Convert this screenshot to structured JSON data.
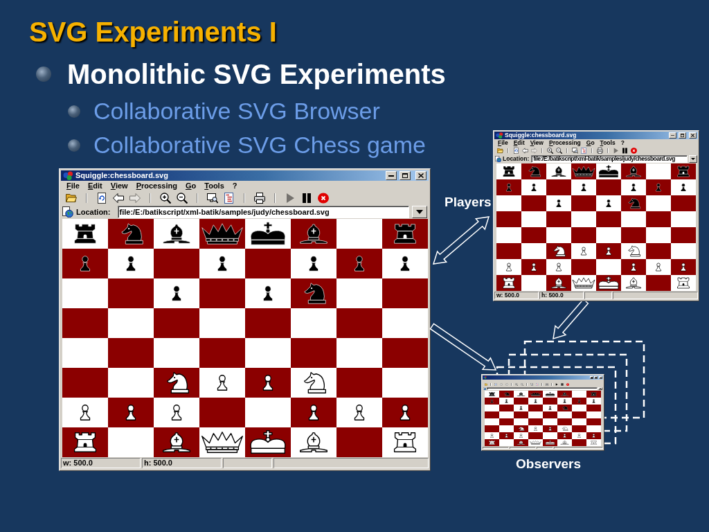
{
  "slide": {
    "title": "SVG Experiments I",
    "bullets": [
      {
        "text": "Monolithic SVG Experiments",
        "children": [
          {
            "text": "Collaborative SVG Browser"
          },
          {
            "text": "Collaborative SVG Chess game"
          }
        ]
      }
    ]
  },
  "main_window": {
    "title": "Squiggle:chessboard.svg",
    "menu": [
      "File",
      "Edit",
      "View",
      "Processing",
      "Go",
      "Tools",
      "?"
    ],
    "toolbar": [
      {
        "kind": "open",
        "disabled": false
      },
      {
        "kind": "separator"
      },
      {
        "kind": "reload",
        "disabled": false
      },
      {
        "kind": "back",
        "disabled": false
      },
      {
        "kind": "forward",
        "disabled": true
      },
      {
        "kind": "separator"
      },
      {
        "kind": "zoom_in",
        "disabled": false
      },
      {
        "kind": "zoom_out",
        "disabled": false
      },
      {
        "kind": "separator"
      },
      {
        "kind": "thumbnail",
        "disabled": false
      },
      {
        "kind": "source",
        "disabled": false
      },
      {
        "kind": "separator"
      },
      {
        "kind": "print",
        "disabled": false
      },
      {
        "kind": "separator"
      },
      {
        "kind": "play",
        "disabled": true
      },
      {
        "kind": "pause",
        "disabled": false
      },
      {
        "kind": "stop",
        "disabled": false
      }
    ],
    "location": {
      "label": "Location:",
      "value": "file:/E:/batikscript/xml-batik/samples/judy/chessboard.svg"
    },
    "board": [
      [
        {
          "kind": "black_rook"
        },
        {
          "kind": "black_knight"
        },
        {
          "kind": "black_bishop"
        },
        {
          "kind": "black_queen"
        },
        {
          "kind": "black_king"
        },
        {
          "kind": "black_bishop"
        },
        {
          "kind": "empty"
        },
        {
          "kind": "black_rook"
        }
      ],
      [
        {
          "kind": "black_pawn"
        },
        {
          "kind": "black_pawn"
        },
        {
          "kind": "empty"
        },
        {
          "kind": "black_pawn"
        },
        {
          "kind": "empty"
        },
        {
          "kind": "black_pawn"
        },
        {
          "kind": "black_pawn"
        },
        {
          "kind": "black_pawn"
        }
      ],
      [
        {
          "kind": "empty"
        },
        {
          "kind": "empty"
        },
        {
          "kind": "black_pawn"
        },
        {
          "kind": "empty"
        },
        {
          "kind": "black_pawn"
        },
        {
          "kind": "black_knight"
        },
        {
          "kind": "empty"
        },
        {
          "kind": "empty"
        }
      ],
      [
        {
          "kind": "empty"
        },
        {
          "kind": "empty"
        },
        {
          "kind": "empty"
        },
        {
          "kind": "empty"
        },
        {
          "kind": "empty"
        },
        {
          "kind": "empty"
        },
        {
          "kind": "empty"
        },
        {
          "kind": "empty"
        }
      ],
      [
        {
          "kind": "empty"
        },
        {
          "kind": "empty"
        },
        {
          "kind": "empty"
        },
        {
          "kind": "empty"
        },
        {
          "kind": "empty"
        },
        {
          "kind": "empty"
        },
        {
          "kind": "empty"
        },
        {
          "kind": "empty"
        }
      ],
      [
        {
          "kind": "empty"
        },
        {
          "kind": "empty"
        },
        {
          "kind": "white_knight"
        },
        {
          "kind": "white_pawn"
        },
        {
          "kind": "white_pawn"
        },
        {
          "kind": "white_knight"
        },
        {
          "kind": "empty"
        },
        {
          "kind": "empty"
        }
      ],
      [
        {
          "kind": "white_pawn"
        },
        {
          "kind": "white_pawn"
        },
        {
          "kind": "white_pawn"
        },
        {
          "kind": "empty"
        },
        {
          "kind": "empty"
        },
        {
          "kind": "white_pawn"
        },
        {
          "kind": "white_pawn"
        },
        {
          "kind": "white_pawn"
        }
      ],
      [
        {
          "kind": "white_rook"
        },
        {
          "kind": "empty"
        },
        {
          "kind": "white_bishop"
        },
        {
          "kind": "white_queen"
        },
        {
          "kind": "white_king"
        },
        {
          "kind": "white_bishop"
        },
        {
          "kind": "empty"
        },
        {
          "kind": "white_rook"
        }
      ]
    ],
    "status": [
      "w: 500.0",
      "h: 500.0"
    ]
  },
  "players_window": {
    "title": "Squiggle:chessboard.svg",
    "menu": [
      "File",
      "Edit",
      "View",
      "Processing",
      "Go",
      "Tools",
      "?"
    ],
    "toolbar": [
      {
        "kind": "open",
        "disabled": false
      },
      {
        "kind": "separator"
      },
      {
        "kind": "reload",
        "disabled": false
      },
      {
        "kind": "back",
        "disabled": false
      },
      {
        "kind": "forward",
        "disabled": true
      },
      {
        "kind": "separator"
      },
      {
        "kind": "zoom_in",
        "disabled": false
      },
      {
        "kind": "zoom_out",
        "disabled": false
      },
      {
        "kind": "separator"
      },
      {
        "kind": "thumbnail",
        "disabled": false
      },
      {
        "kind": "source",
        "disabled": false
      },
      {
        "kind": "separator"
      },
      {
        "kind": "print",
        "disabled": false
      },
      {
        "kind": "separator"
      },
      {
        "kind": "play",
        "disabled": true
      },
      {
        "kind": "pause",
        "disabled": false
      },
      {
        "kind": "stop",
        "disabled": false
      }
    ],
    "location": {
      "label": "Location:",
      "value": "file:/E:/batikscript/xml-batik/samples/judy/chessboard.svg"
    },
    "board": [
      [
        {
          "kind": "black_rook"
        },
        {
          "kind": "black_knight"
        },
        {
          "kind": "black_bishop"
        },
        {
          "kind": "black_queen"
        },
        {
          "kind": "black_king"
        },
        {
          "kind": "black_bishop"
        },
        {
          "kind": "empty"
        },
        {
          "kind": "black_rook"
        }
      ],
      [
        {
          "kind": "black_pawn"
        },
        {
          "kind": "black_pawn"
        },
        {
          "kind": "empty"
        },
        {
          "kind": "black_pawn"
        },
        {
          "kind": "empty"
        },
        {
          "kind": "black_pawn"
        },
        {
          "kind": "black_pawn"
        },
        {
          "kind": "black_pawn"
        }
      ],
      [
        {
          "kind": "empty"
        },
        {
          "kind": "empty"
        },
        {
          "kind": "black_pawn"
        },
        {
          "kind": "empty"
        },
        {
          "kind": "black_pawn"
        },
        {
          "kind": "black_knight"
        },
        {
          "kind": "empty"
        },
        {
          "kind": "empty"
        }
      ],
      [
        {
          "kind": "empty"
        },
        {
          "kind": "empty"
        },
        {
          "kind": "empty"
        },
        {
          "kind": "empty"
        },
        {
          "kind": "empty"
        },
        {
          "kind": "empty"
        },
        {
          "kind": "empty"
        },
        {
          "kind": "empty"
        }
      ],
      [
        {
          "kind": "empty"
        },
        {
          "kind": "empty"
        },
        {
          "kind": "empty"
        },
        {
          "kind": "empty"
        },
        {
          "kind": "empty"
        },
        {
          "kind": "empty"
        },
        {
          "kind": "empty"
        },
        {
          "kind": "empty"
        }
      ],
      [
        {
          "kind": "empty"
        },
        {
          "kind": "empty"
        },
        {
          "kind": "white_knight"
        },
        {
          "kind": "white_pawn"
        },
        {
          "kind": "white_pawn"
        },
        {
          "kind": "white_knight"
        },
        {
          "kind": "empty"
        },
        {
          "kind": "empty"
        }
      ],
      [
        {
          "kind": "white_pawn"
        },
        {
          "kind": "white_pawn"
        },
        {
          "kind": "white_pawn"
        },
        {
          "kind": "empty"
        },
        {
          "kind": "empty"
        },
        {
          "kind": "white_pawn"
        },
        {
          "kind": "white_pawn"
        },
        {
          "kind": "white_pawn"
        }
      ],
      [
        {
          "kind": "white_rook"
        },
        {
          "kind": "empty"
        },
        {
          "kind": "white_bishop"
        },
        {
          "kind": "white_queen"
        },
        {
          "kind": "white_king"
        },
        {
          "kind": "white_bishop"
        },
        {
          "kind": "empty"
        },
        {
          "kind": "white_rook"
        }
      ]
    ],
    "status": [
      "w: 500.0",
      "h: 500.0"
    ]
  },
  "observer_window": {
    "toolbar": [
      {
        "kind": "open"
      },
      {
        "kind": "separator"
      },
      {
        "kind": "reload"
      },
      {
        "kind": "back"
      },
      {
        "kind": "forward"
      },
      {
        "kind": "separator"
      },
      {
        "kind": "zoom_in"
      },
      {
        "kind": "zoom_out"
      },
      {
        "kind": "separator"
      },
      {
        "kind": "thumbnail"
      },
      {
        "kind": "source"
      },
      {
        "kind": "separator"
      },
      {
        "kind": "print"
      },
      {
        "kind": "separator"
      },
      {
        "kind": "play"
      },
      {
        "kind": "pause"
      },
      {
        "kind": "stop"
      }
    ],
    "board": [
      [
        {
          "kind": "black_rook"
        },
        {
          "kind": "black_knight"
        },
        {
          "kind": "black_bishop"
        },
        {
          "kind": "black_queen"
        },
        {
          "kind": "black_king"
        },
        {
          "kind": "black_bishop"
        },
        {
          "kind": "empty"
        },
        {
          "kind": "black_rook"
        }
      ],
      [
        {
          "kind": "black_pawn"
        },
        {
          "kind": "black_pawn"
        },
        {
          "kind": "empty"
        },
        {
          "kind": "black_pawn"
        },
        {
          "kind": "empty"
        },
        {
          "kind": "black_pawn"
        },
        {
          "kind": "black_pawn"
        },
        {
          "kind": "black_pawn"
        }
      ],
      [
        {
          "kind": "empty"
        },
        {
          "kind": "empty"
        },
        {
          "kind": "black_pawn"
        },
        {
          "kind": "empty"
        },
        {
          "kind": "black_pawn"
        },
        {
          "kind": "black_knight"
        },
        {
          "kind": "empty"
        },
        {
          "kind": "empty"
        }
      ],
      [
        {
          "kind": "empty"
        },
        {
          "kind": "empty"
        },
        {
          "kind": "empty"
        },
        {
          "kind": "empty"
        },
        {
          "kind": "empty"
        },
        {
          "kind": "empty"
        },
        {
          "kind": "empty"
        },
        {
          "kind": "empty"
        }
      ],
      [
        {
          "kind": "empty"
        },
        {
          "kind": "empty"
        },
        {
          "kind": "empty"
        },
        {
          "kind": "empty"
        },
        {
          "kind": "empty"
        },
        {
          "kind": "empty"
        },
        {
          "kind": "empty"
        },
        {
          "kind": "empty"
        }
      ],
      [
        {
          "kind": "empty"
        },
        {
          "kind": "empty"
        },
        {
          "kind": "white_knight"
        },
        {
          "kind": "white_pawn"
        },
        {
          "kind": "white_pawn"
        },
        {
          "kind": "white_knight"
        },
        {
          "kind": "empty"
        },
        {
          "kind": "empty"
        }
      ],
      [
        {
          "kind": "white_pawn"
        },
        {
          "kind": "white_pawn"
        },
        {
          "kind": "white_pawn"
        },
        {
          "kind": "empty"
        },
        {
          "kind": "empty"
        },
        {
          "kind": "white_pawn"
        },
        {
          "kind": "white_pawn"
        },
        {
          "kind": "white_pawn"
        }
      ],
      [
        {
          "kind": "white_rook"
        },
        {
          "kind": "empty"
        },
        {
          "kind": "white_bishop"
        },
        {
          "kind": "white_queen"
        },
        {
          "kind": "white_king"
        },
        {
          "kind": "white_bishop"
        },
        {
          "kind": "empty"
        },
        {
          "kind": "white_rook"
        }
      ]
    ]
  },
  "diagram": {
    "players_label": "Players",
    "observers_label": "Observers"
  }
}
